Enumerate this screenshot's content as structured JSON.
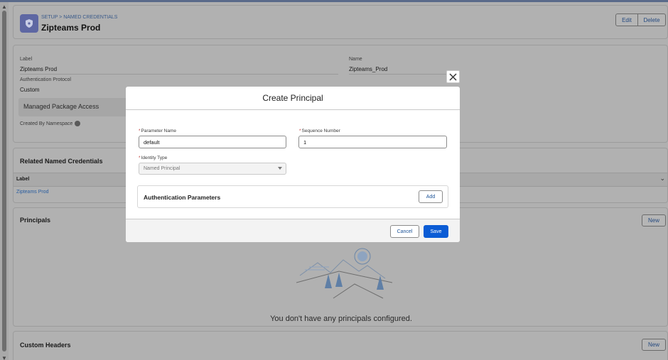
{
  "breadcrumb": "SETUP > NAMED CREDENTIALS",
  "title": "Zipteams Prod",
  "actions": {
    "edit": "Edit",
    "delete": "Delete"
  },
  "details": {
    "label_label": "Label",
    "label_value": "Zipteams Prod",
    "name_label": "Name",
    "name_value": "Zipteams_Prod",
    "auth_protocol_label": "Authentication Protocol",
    "auth_protocol_value": "Custom",
    "managed_package_access": "Managed Package Access",
    "created_by_namespace": "Created By Namespace"
  },
  "related": {
    "title": "Related Named Credentials",
    "column_label": "Label",
    "rows": [
      "Zipteams Prod"
    ]
  },
  "principals": {
    "title": "Principals",
    "new_label": "New",
    "empty_message": "You don't have any principals configured."
  },
  "custom_headers": {
    "title": "Custom Headers",
    "new_label": "New"
  },
  "modal": {
    "title": "Create Principal",
    "param_name_label": "Parameter Name",
    "param_name_value": "default",
    "seq_label": "Sequence Number",
    "seq_value": "1",
    "identity_label": "Identity Type",
    "identity_value": "Named Principal",
    "auth_params_title": "Authentication Parameters",
    "add_label": "Add",
    "cancel_label": "Cancel",
    "save_label": "Save",
    "required_marker": "*"
  },
  "colors": {
    "save": "#0b5cd5",
    "link": "#2a5ea0",
    "overlay": "#b0b0b0"
  }
}
